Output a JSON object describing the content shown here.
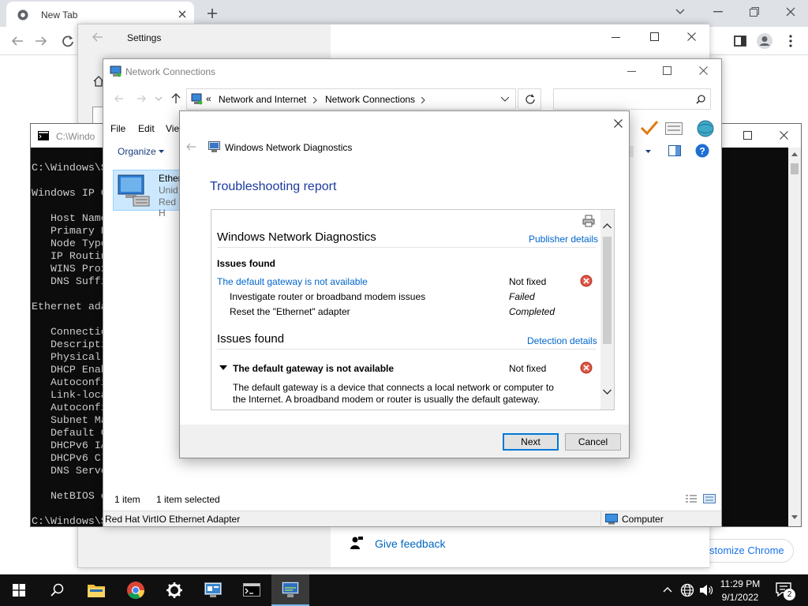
{
  "chrome": {
    "tab_title": "New Tab",
    "customize_label": "stomize Chrome",
    "colors": {
      "tabstrip": "#dee1e6",
      "link": "#1a73e8"
    }
  },
  "settings": {
    "title": "Settings",
    "give_feedback": "Give feedback"
  },
  "cmd": {
    "title": "C:\\Windo",
    "lines": [
      "C:\\Windows\\S",
      "",
      "Windows IP C",
      "",
      "   Host Name",
      "   Primary D",
      "   Node Type",
      "   IP Routin",
      "   WINS Prox",
      "   DNS Suffi",
      "",
      "Ethernet ada",
      "",
      "   Connectio",
      "   Descripti",
      "   Physical",
      "   DHCP Enab",
      "   Autoconfi",
      "   Link-loca",
      "   Autoconfi",
      "   Subnet Ma",
      "   Default G",
      "   DHCPv6 IA",
      "   DHCPv6 Cl",
      "   DNS Serve",
      "",
      "   NetBIOS o",
      "",
      "C:\\Windows\\S"
    ]
  },
  "netconn": {
    "title": "Network Connections",
    "breadcrumb": {
      "prefix": "«",
      "item1": "Network and Internet",
      "item2": "Network Connections"
    },
    "menu": {
      "file": "File",
      "edit": "Edit",
      "view": "Vie"
    },
    "organize": "Organize",
    "item": {
      "name": "Ether",
      "status": "Unid",
      "adapter": "Red H"
    },
    "status": {
      "count": "1 item",
      "selected": "1 item selected"
    },
    "footer": {
      "adapter": "Red Hat VirtIO Ethernet Adapter",
      "computer": "Computer"
    }
  },
  "diag": {
    "title": "Windows Network Diagnostics",
    "heading": "Troubleshooting report",
    "report": {
      "section_title": "Windows Network Diagnostics",
      "publisher_link": "Publisher details",
      "issues_found_bold": "Issues found",
      "issue_link": "The default gateway is not available",
      "issue_status": "Not fixed",
      "step1": "Investigate router or broadband modem issues",
      "step1_status": "Failed",
      "step2": "Reset the \"Ethernet\" adapter",
      "step2_status": "Completed",
      "issues_found_2": "Issues found",
      "detection_link": "Detection details",
      "detail_title": "The default gateway is not available",
      "detail_status": "Not fixed",
      "detail_line1": "The default gateway is a device that connects a local network or computer to",
      "detail_line2": "the Internet. A broadband modem or router is usually the default gateway."
    },
    "buttons": {
      "next": "Next",
      "cancel": "Cancel"
    },
    "colors": {
      "heading": "#1c3a9f",
      "link": "#0066cc",
      "error": "#c0392b"
    }
  },
  "taskbar": {
    "time": "11:29 PM",
    "date": "9/1/2022",
    "notification_count": "2"
  }
}
